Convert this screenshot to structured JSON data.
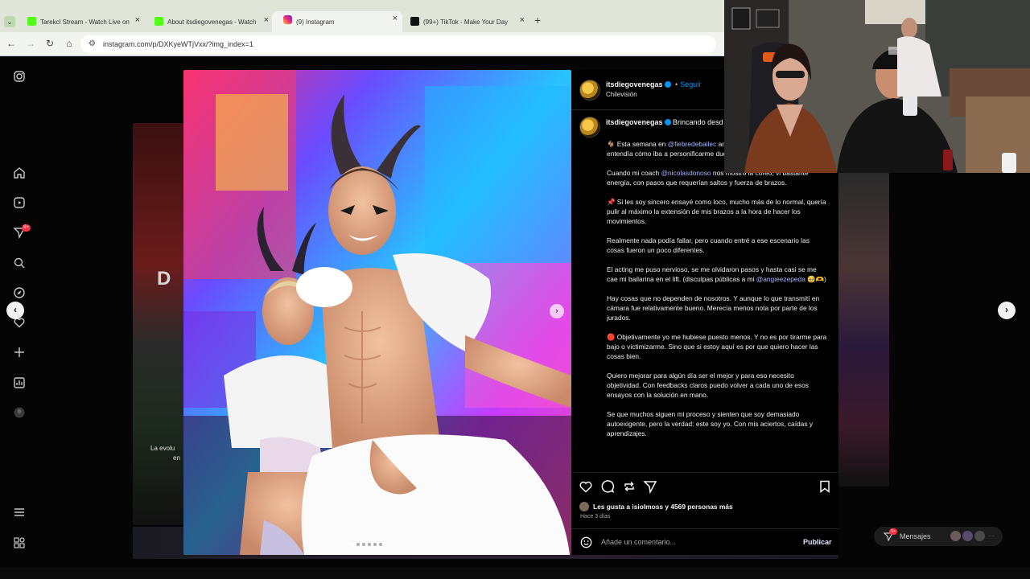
{
  "browser": {
    "tabs": [
      {
        "title": "Tarekcl Stream - Watch Live on",
        "favicon_color": "#53fc18",
        "active": false
      },
      {
        "title": "About itsdiegovenegas - Watch",
        "favicon_color": "#53fc18",
        "active": false
      },
      {
        "title": "(9) Instagram",
        "favicon_color": "#e1306c",
        "active": true
      },
      {
        "title": "(99+) TikTok - Make Your Day",
        "favicon_color": "#111111",
        "active": false
      }
    ],
    "url": "instagram.com/p/DXKyeWTjVxx/?img_index=1"
  },
  "post": {
    "author": "itsdiegovenegas",
    "follow_label": "Seguir",
    "separator": "•",
    "location": "Chilevisión",
    "caption_author": "itsdiegovenegas",
    "caption_first_line": "Brincando desd",
    "caption": [
      {
        "text": "🐐 Esta semana en ",
        "mention": "@fiebredebailec",
        "rest": " animales y a mi me tocó ser una CA entendía cómo iba a personificarme duda quería dar lo mejor de mí..."
      },
      {
        "text": "Cuando mi coach ",
        "mention": "@nicolasdonoso",
        "rest": " nos mostró la coreo, vi bastante energía, con pasos que requerían saltos y fuerza de brazos."
      },
      {
        "text": "📌 Si les soy sincero ensayé como loco, mucho más de lo normal, quería pulir al máximo la extensión de mis brazos a la hora de hacer los movimientos.",
        "mention": "",
        "rest": ""
      },
      {
        "text": "Realmente nada podía fallar, pero cuando entré a ese escenario las cosas fueron un poco diferentes.",
        "mention": "",
        "rest": ""
      },
      {
        "text": "El acting me puso nervioso, se me olvidaron pasos y hasta casi se me cae mi bailarina en el lift. (disculpas públicas a mi ",
        "mention": "@angieezepeda",
        "rest": " 🥹🫶)"
      },
      {
        "text": "Hay cosas que no dependen de nosotros. Y aunque lo que transmití en cámara fue relativamente bueno. Merecía menos nota por parte de los jurados.",
        "mention": "",
        "rest": ""
      },
      {
        "text": "🔴 Objetivamente yo me hubiese puesto menos. Y no es por tirarme para bajo o victimizarme. Sino que si estoy aquí es por que quiero hacer las cosas bien.",
        "mention": "",
        "rest": ""
      },
      {
        "text": "Quiero mejorar para algún día ser el mejor y para eso necesito objetividad. Con feedbacks claros puedo volver a cada uno de esos ensayos con la solución en mano.",
        "mention": "",
        "rest": ""
      },
      {
        "text": "Se que muchos siguen mi proceso y sienten que soy demasiado autoexigente, pero la verdad: este soy yo. Con mis aciertos, caídas y aprendizajes.",
        "mention": "",
        "rest": ""
      }
    ],
    "likes_text": "Les gusta a isiolmoss y 4569 personas más",
    "time_ago": "Hace 3 días",
    "comment_placeholder": "Añade un comentario...",
    "publish_label": "Publicar"
  },
  "background": {
    "left_card_text": "La evolu",
    "left_card_text2": "en"
  },
  "sidebar": {
    "notification_badge": "9+"
  },
  "messages": {
    "label": "Mensajes"
  }
}
